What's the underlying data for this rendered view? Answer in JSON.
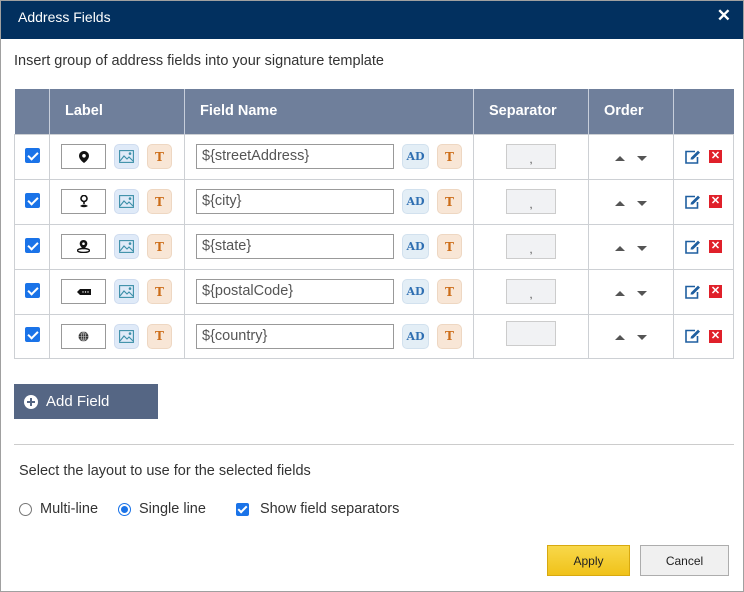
{
  "dialog": {
    "title": "Address Fields",
    "close_icon": "close-icon",
    "intro": "Insert group of address fields into your signature template"
  },
  "table": {
    "headers": [
      "",
      "Label",
      "Field Name",
      "Separator",
      "Order",
      ""
    ],
    "rows": [
      {
        "checked": true,
        "label_icon": "map-pin-icon",
        "field_name": "${streetAddress}",
        "separator": ","
      },
      {
        "checked": true,
        "label_icon": "person-pin-icon",
        "field_name": "${city}",
        "separator": ","
      },
      {
        "checked": true,
        "label_icon": "location-pin-icon",
        "field_name": "${state}",
        "separator": ","
      },
      {
        "checked": true,
        "label_icon": "postal-tag-icon",
        "field_name": "${postalCode}",
        "separator": ","
      },
      {
        "checked": true,
        "label_icon": "globe-icon",
        "field_name": "${country}",
        "separator": ""
      }
    ],
    "ad_button_label": "AD",
    "text_button_label": "T"
  },
  "add_field_label": "Add Field",
  "layout": {
    "prompt": "Select the layout to use for the selected fields",
    "options": [
      {
        "label": "Multi-line",
        "selected": false
      },
      {
        "label": "Single line",
        "selected": true
      }
    ],
    "show_separators_label": "Show field separators",
    "show_separators_checked": true
  },
  "footer": {
    "apply_label": "Apply",
    "cancel_label": "Cancel"
  },
  "colors": {
    "title_bar": "#02305f",
    "table_header": "#6f7f9b",
    "add_button": "#556684",
    "apply_button": "#f0c21a",
    "checkbox": "#1a73e8",
    "delete": "#e0202a"
  }
}
